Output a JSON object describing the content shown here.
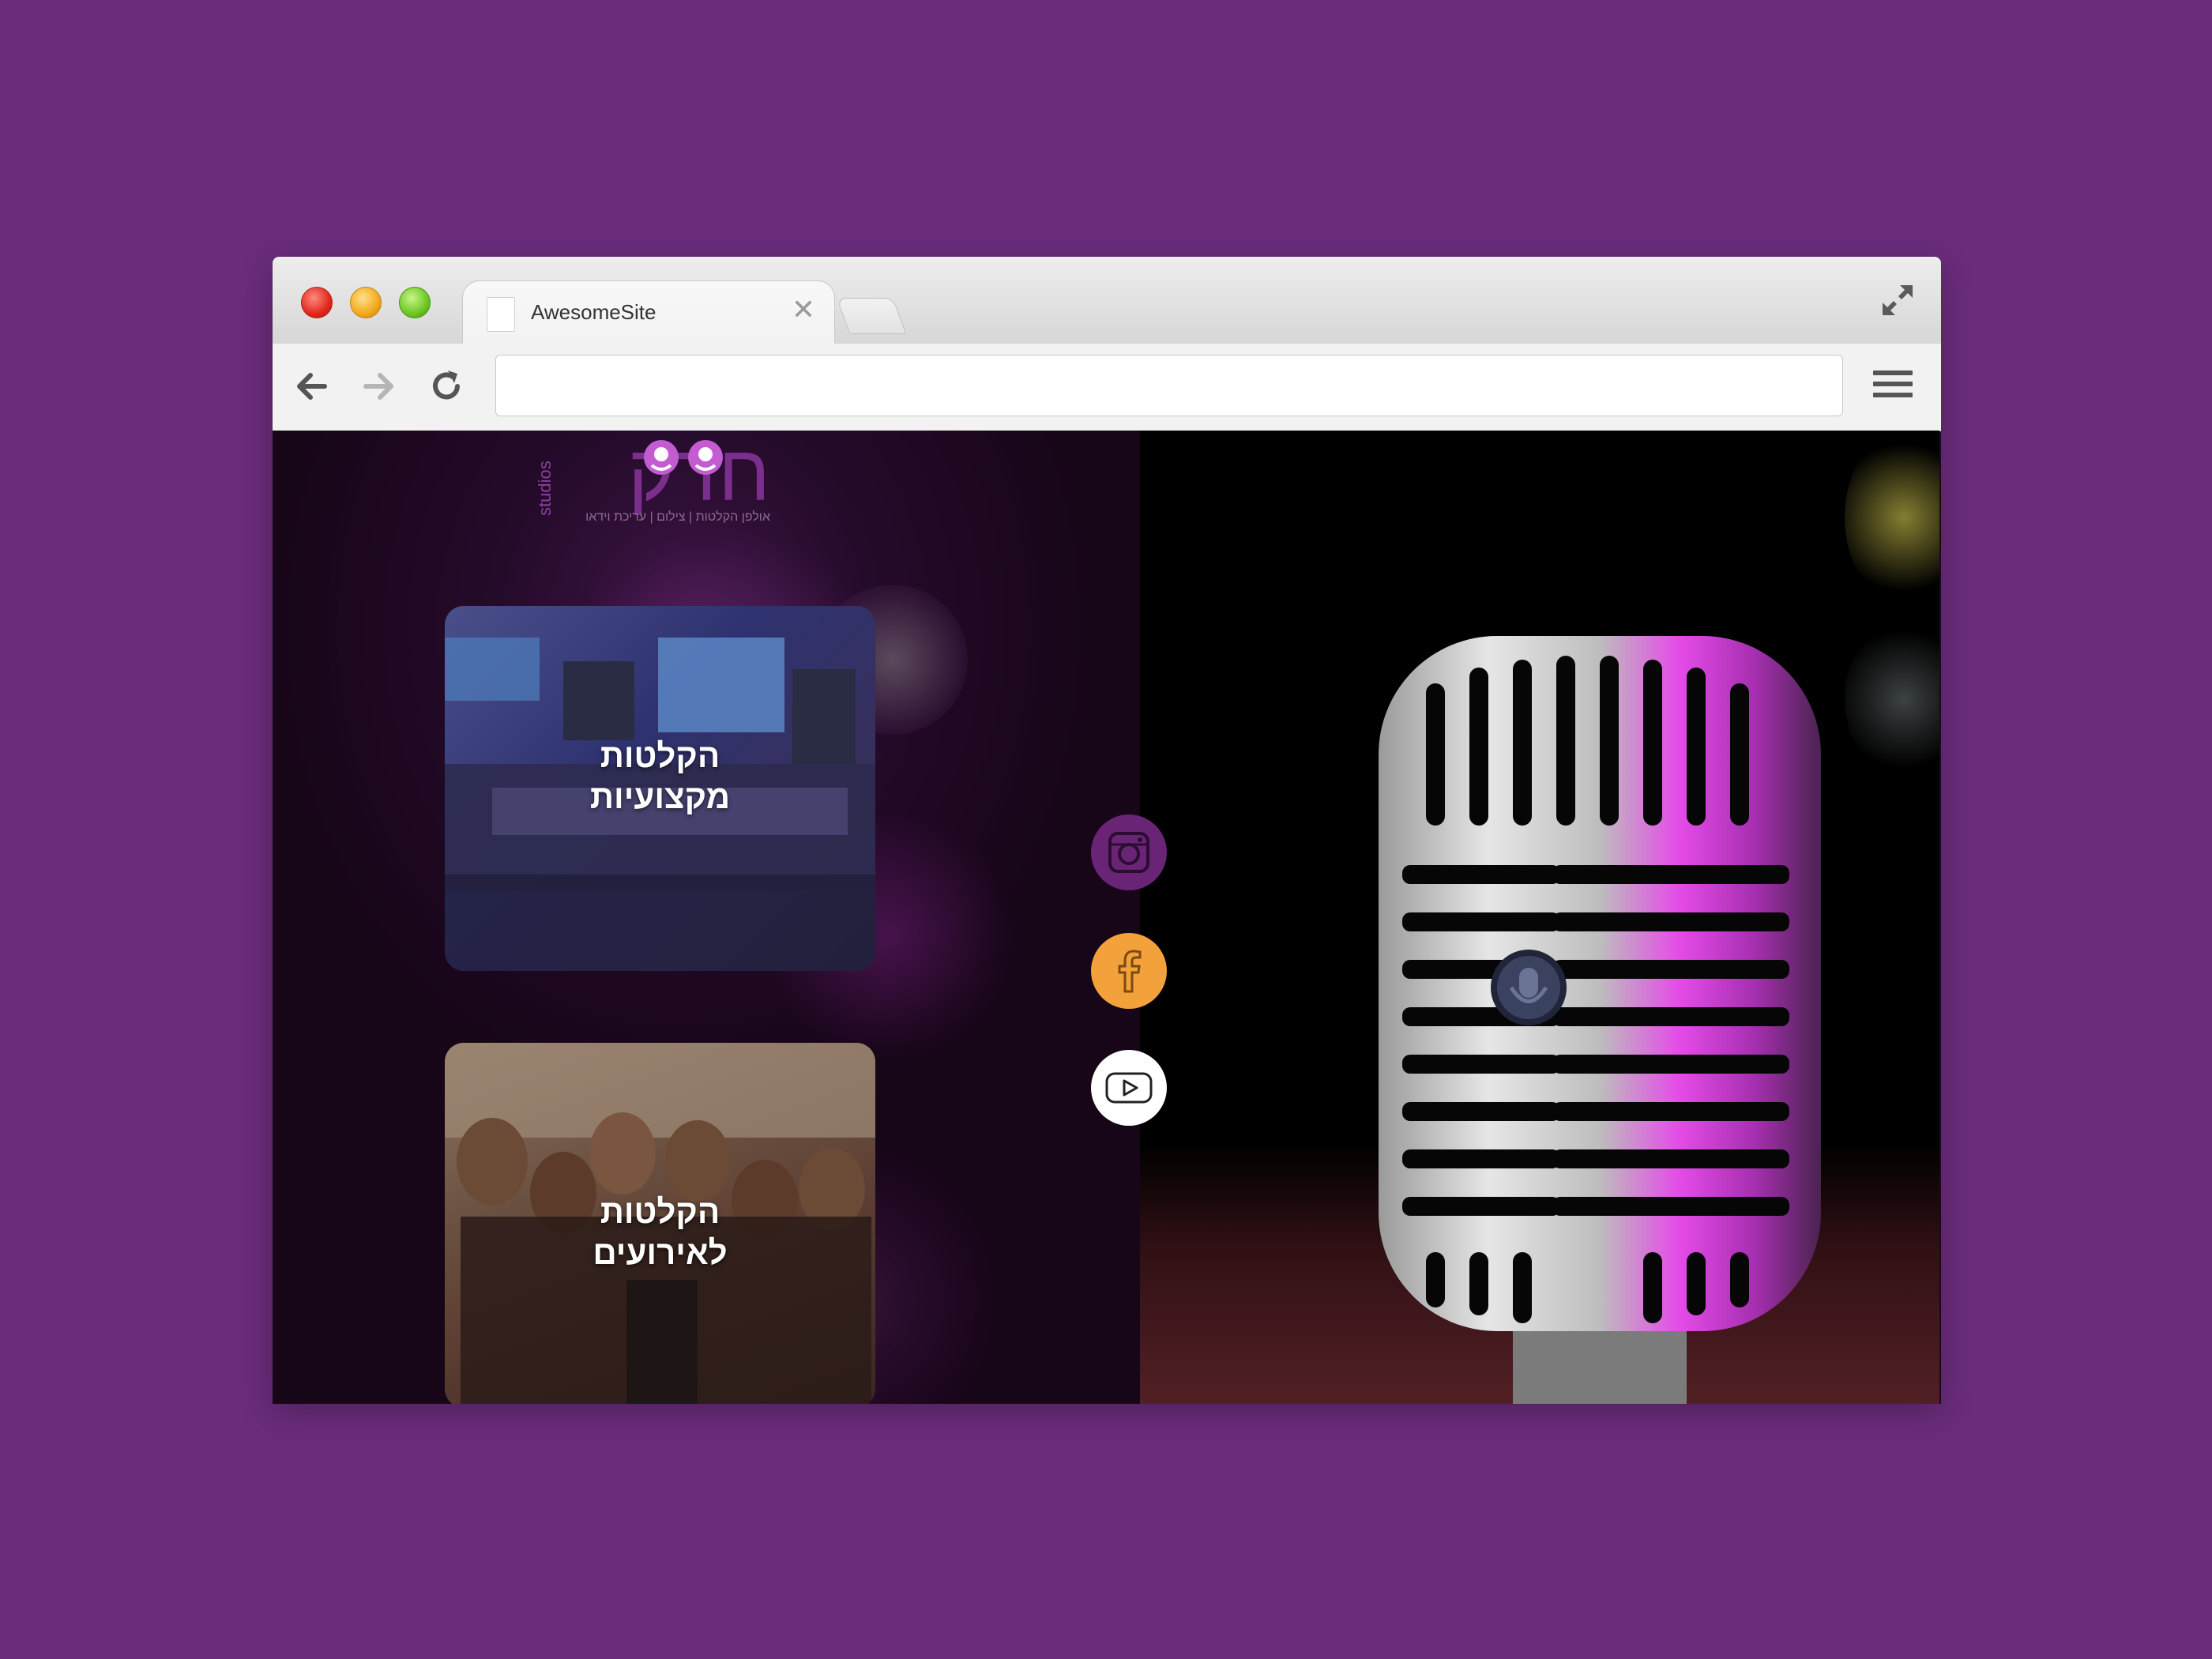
{
  "browser": {
    "tab_title": "AwesomeSite",
    "tab_close": "✕",
    "url_value": "",
    "url_placeholder": ""
  },
  "site": {
    "logo_text": "חדק",
    "logo_sub": "studios",
    "logo_tagline": "אולפן הקלטות | צילום | עריכת וידאו",
    "cards": [
      {
        "title_line1": "הקלטות",
        "title_line2": "מקצועיות"
      },
      {
        "title_line1": "הקלטות",
        "title_line2": "לאירועים"
      }
    ],
    "social": [
      {
        "name": "instagram-icon",
        "color": "#6a2476"
      },
      {
        "name": "facebook-icon",
        "color": "#f3a13b"
      },
      {
        "name": "youtube-icon",
        "color": "#ffffff"
      }
    ]
  },
  "colors": {
    "background": "#6a2c7b",
    "accent_purple": "#6a2476",
    "accent_orange": "#f3a13b"
  }
}
